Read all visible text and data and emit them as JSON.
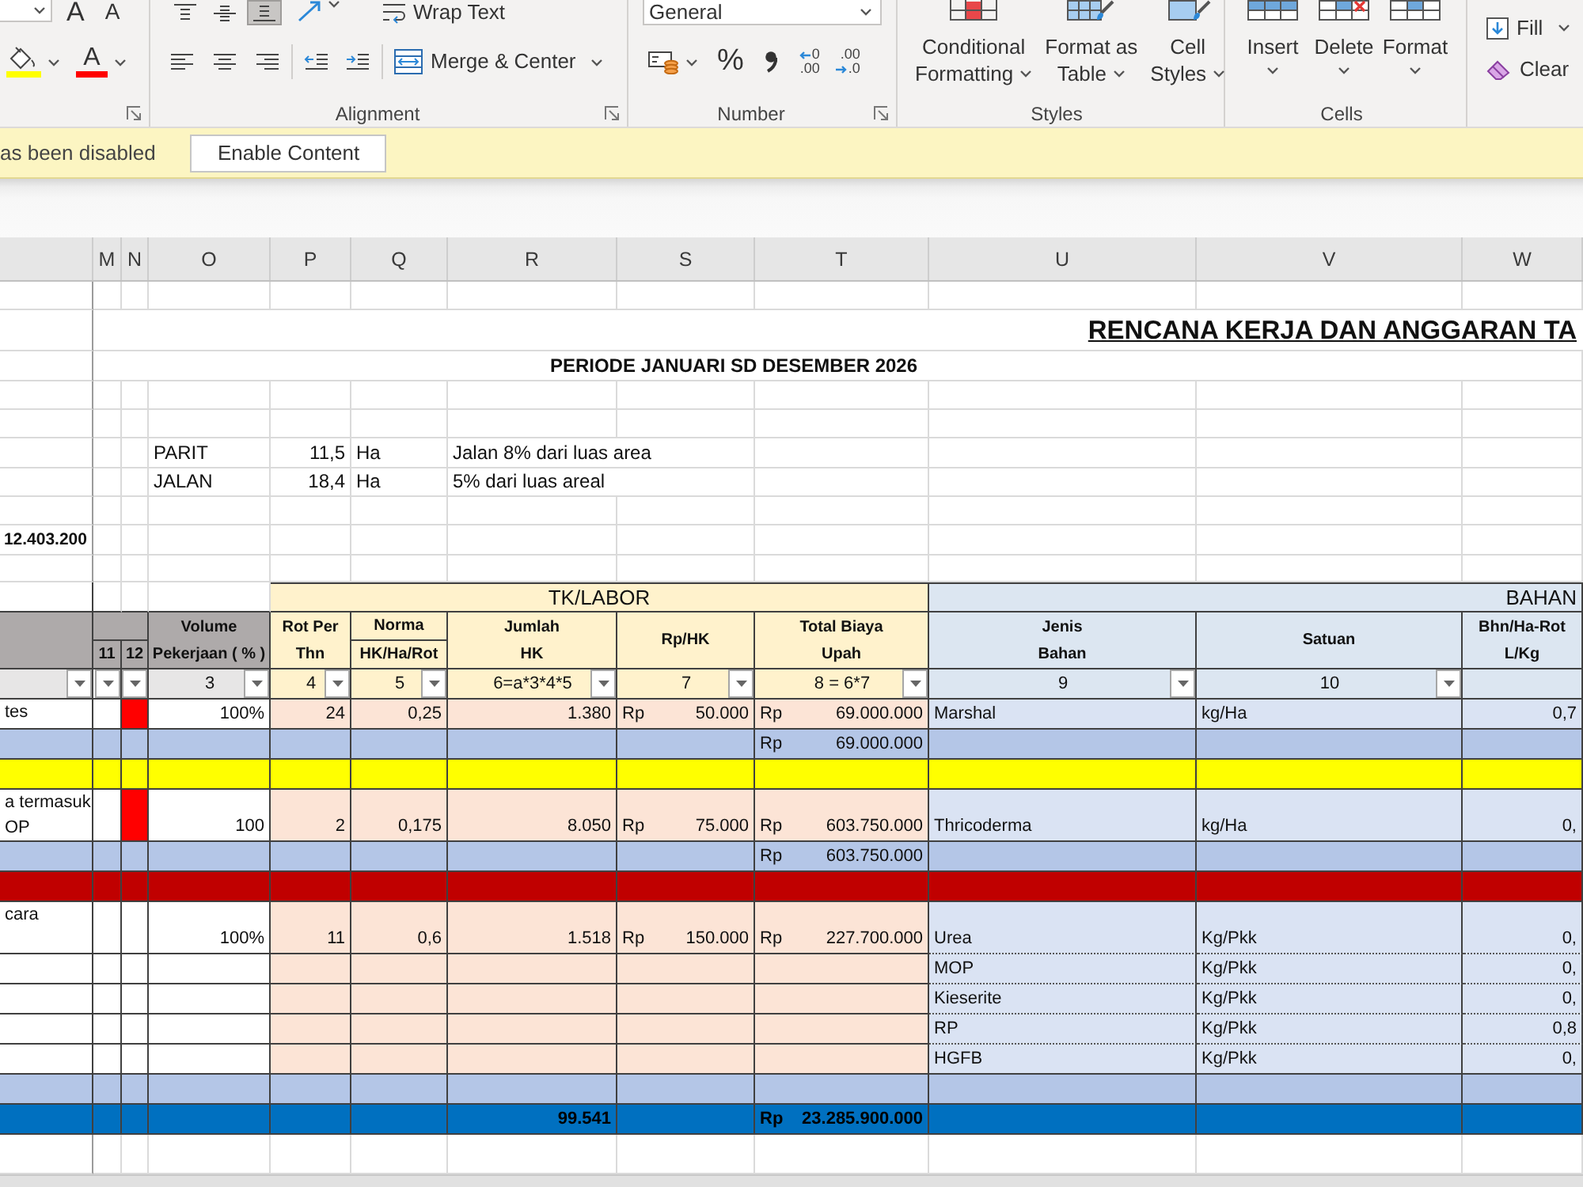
{
  "ribbon": {
    "font": {
      "grow": "A",
      "shrink": "A",
      "font_color": "A"
    },
    "alignment": {
      "label": "Alignment",
      "vertical": [
        {
          "kind": "top",
          "selected": false
        },
        {
          "kind": "middle",
          "selected": false
        },
        {
          "kind": "bottom",
          "selected": true
        }
      ],
      "wrap_text": "Wrap Text",
      "merge": "Merge & Center"
    },
    "number": {
      "label": "Number",
      "format": "General",
      "percent": "%",
      "increase_decimal": [
        "0",
        ".00"
      ],
      "decrease_decimal": [
        ".00",
        ".0"
      ]
    },
    "styles": {
      "label": "Styles",
      "buttons": [
        {
          "kind": "conditional",
          "lines": [
            "Conditional",
            "Formatting"
          ]
        },
        {
          "kind": "table",
          "lines": [
            "Format as",
            "Table"
          ]
        },
        {
          "kind": "cell",
          "lines": [
            "Cell",
            "Styles"
          ]
        }
      ]
    },
    "cells": {
      "label": "Cells",
      "buttons": [
        {
          "kind": "insert",
          "label": "Insert"
        },
        {
          "kind": "delete",
          "label": "Delete"
        },
        {
          "kind": "format",
          "label": "Format"
        }
      ]
    },
    "editing": {
      "buttons": [
        {
          "kind": "fill",
          "label": "Fill"
        },
        {
          "kind": "clear",
          "label": "Clear"
        }
      ]
    }
  },
  "message_bar": {
    "text": "as been disabled",
    "button": "Enable Content"
  },
  "sheet": {
    "columns": [
      "M",
      "N",
      "O",
      "P",
      "Q",
      "R",
      "S",
      "T",
      "U",
      "V",
      "W"
    ],
    "title": "RENCANA KERJA DAN ANGGARAN TA",
    "period": "PERIODE JANUARI SD DESEMBER 2026",
    "areas": [
      {
        "name": "PARIT",
        "size": "11,5",
        "unit": "Ha",
        "note": "Jalan 8% dari luas area"
      },
      {
        "name": "JALAN",
        "size": "18,4",
        "unit": "Ha",
        "note": "5% dari luas areal"
      }
    ],
    "summary": "12.403.200",
    "table": {
      "groups": [
        {
          "kind": "labor",
          "label": "TK/LABOR"
        },
        {
          "kind": "material",
          "label": "BAHAN"
        }
      ],
      "flag_headers": [
        "11",
        "12"
      ],
      "headers": [
        {
          "kind": "merged",
          "lines": [
            "Volume",
            "Pekerjaan ( % )"
          ],
          "filter": "3"
        },
        {
          "kind": "merged",
          "lines": [
            "Rot Per",
            "Thn"
          ],
          "filter": "4"
        },
        {
          "kind": "split",
          "lines": [
            "Norma",
            "HK/Ha/Rot"
          ],
          "filter": "5"
        },
        {
          "kind": "merged",
          "lines": [
            "Jumlah",
            "HK"
          ],
          "filter": "6=a*3*4*5"
        },
        {
          "kind": "merged",
          "lines": [
            "Rp/HK"
          ],
          "filter": "7"
        },
        {
          "kind": "merged",
          "lines": [
            "Total Biaya",
            "Upah"
          ],
          "filter": "8 = 6*7"
        },
        {
          "kind": "merged",
          "lines": [
            "Jenis",
            "Bahan"
          ],
          "filter": "9"
        },
        {
          "kind": "merged",
          "lines": [
            "Satuan"
          ],
          "filter": "10"
        },
        {
          "kind": "merged",
          "lines": [
            "Bhn/Ha-Rot",
            "L/Kg"
          ]
        }
      ],
      "rows": [
        {
          "kind": "item",
          "label": [
            "tes"
          ],
          "flag": true,
          "volume": "100%",
          "rotation": "24",
          "norm": "0,25",
          "workdays": "1.380",
          "rate": {
            "currency": "Rp",
            "amount": "50.000"
          },
          "wage": {
            "currency": "Rp",
            "amount": "69.000.000"
          },
          "materials": [
            {
              "name": "Marshal",
              "unit": "kg/Ha",
              "dose": "0,7"
            }
          ]
        },
        {
          "kind": "subtotal",
          "wage": {
            "currency": "Rp",
            "amount": "69.000.000"
          }
        },
        {
          "kind": "separator",
          "color": "#ffff00"
        },
        {
          "kind": "item",
          "label": [
            "a termasuk",
            "OP"
          ],
          "flag": true,
          "volume": "100",
          "rotation": "2",
          "norm": "0,175",
          "workdays": "8.050",
          "rate": {
            "currency": "Rp",
            "amount": "75.000"
          },
          "wage": {
            "currency": "Rp",
            "amount": "603.750.000"
          },
          "materials": [
            {
              "name": "Thricoderma",
              "unit": "kg/Ha",
              "dose": "0,"
            }
          ]
        },
        {
          "kind": "subtotal",
          "wage": {
            "currency": "Rp",
            "amount": "603.750.000"
          }
        },
        {
          "kind": "separator",
          "color": "#c00000"
        },
        {
          "kind": "item",
          "label": [
            "cara"
          ],
          "flag": false,
          "volume": "100%",
          "rotation": "11",
          "norm": "0,6",
          "workdays": "1.518",
          "rate": {
            "currency": "Rp",
            "amount": "150.000"
          },
          "wage": {
            "currency": "Rp",
            "amount": "227.700.000"
          },
          "materials": [
            {
              "name": "Urea",
              "unit": "Kg/Pkk",
              "dose": "0,"
            },
            {
              "name": "MOP",
              "unit": "Kg/Pkk",
              "dose": "0,"
            },
            {
              "name": "Kieserite",
              "unit": "Kg/Pkk",
              "dose": "0,"
            },
            {
              "name": "RP",
              "unit": "Kg/Pkk",
              "dose": "0,8"
            },
            {
              "name": "HGFB",
              "unit": "Kg/Pkk",
              "dose": "0,"
            }
          ]
        },
        {
          "kind": "subtotal"
        },
        {
          "kind": "total",
          "workdays": "99.541",
          "wage": {
            "currency": "Rp",
            "amount": "23.285.900.000"
          }
        }
      ]
    }
  }
}
